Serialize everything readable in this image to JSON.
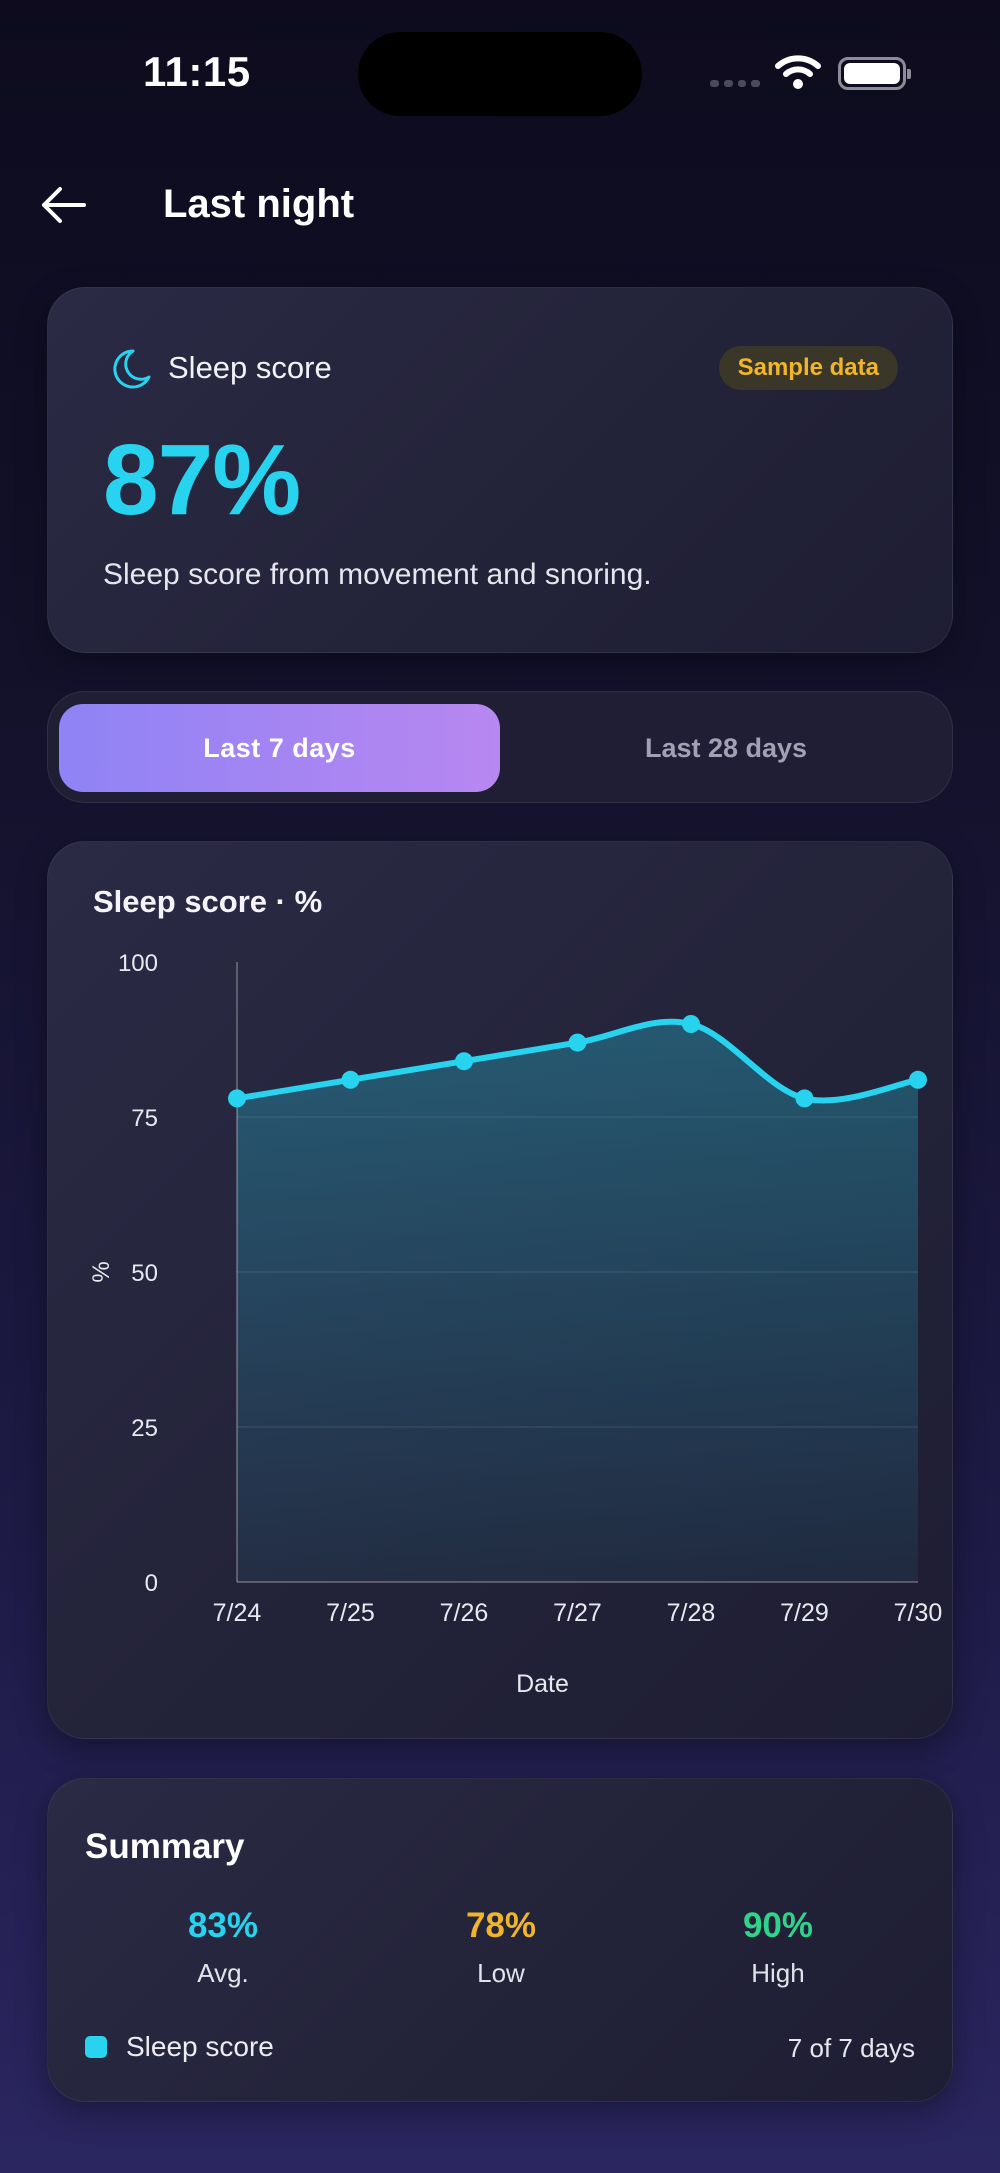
{
  "status_bar": {
    "time": "11:15"
  },
  "header": {
    "title": "Last night"
  },
  "score_card": {
    "label": "Sleep score",
    "badge": "Sample data",
    "value": "87%",
    "description": "Sleep score from movement and snoring."
  },
  "range_tabs": [
    {
      "label": "Last 7 days",
      "active": true
    },
    {
      "label": "Last 28 days",
      "active": false
    }
  ],
  "chart_data": {
    "type": "area",
    "title": "Sleep score · %",
    "xlabel": "Date",
    "ylabel": "%",
    "categories": [
      "7/24",
      "7/25",
      "7/26",
      "7/27",
      "7/28",
      "7/29",
      "7/30"
    ],
    "values": [
      78,
      81,
      84,
      87,
      90,
      78,
      81
    ],
    "ylim": [
      0,
      100
    ],
    "yticks": [
      0,
      25,
      50,
      75,
      100
    ],
    "grid": true,
    "color": "#27d3ee"
  },
  "summary": {
    "title": "Summary",
    "stats": [
      {
        "value": "83%",
        "label": "Avg.",
        "color": "#27d3ee"
      },
      {
        "value": "78%",
        "label": "Low",
        "color": "#f0b52a"
      },
      {
        "value": "90%",
        "label": "High",
        "color": "#2fd38a"
      }
    ],
    "legend_label": "Sleep score",
    "days": "7 of 7 days"
  }
}
